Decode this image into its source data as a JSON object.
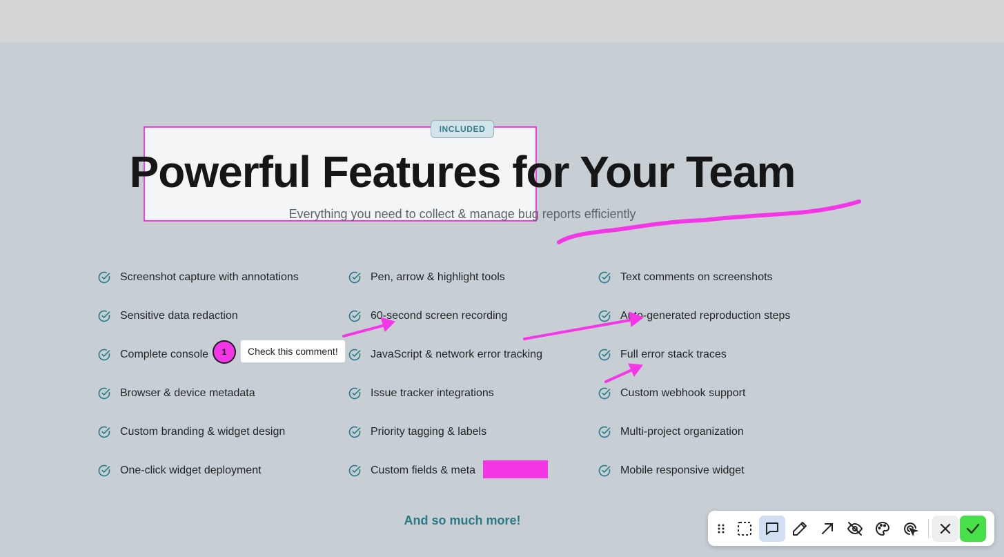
{
  "header": {
    "badge": "INCLUDED",
    "title": "Powerful Features for Your Team",
    "subtitle": "Everything you need to collect & manage bug reports efficiently"
  },
  "features": [
    {
      "label": "Screenshot capture with annotations",
      "icon": "check-circle-icon"
    },
    {
      "label": "Pen, arrow & highlight tools",
      "icon": "check-circle-icon"
    },
    {
      "label": "Text comments on screenshots",
      "icon": "check-circle-icon"
    },
    {
      "label": "Sensitive data redaction",
      "icon": "check-circle-icon"
    },
    {
      "label": "60-second screen recording",
      "icon": "check-circle-icon"
    },
    {
      "label": "Auto-generated reproduction steps",
      "icon": "check-circle-icon"
    },
    {
      "label": "Complete console",
      "icon": "check-circle-icon"
    },
    {
      "label": "JavaScript & network error tracking",
      "icon": "check-circle-icon"
    },
    {
      "label": "Full error stack traces",
      "icon": "check-circle-icon"
    },
    {
      "label": "Browser & device metadata",
      "icon": "check-circle-icon"
    },
    {
      "label": "Issue tracker integrations",
      "icon": "check-circle-icon"
    },
    {
      "label": "Custom webhook support",
      "icon": "check-circle-icon"
    },
    {
      "label": "Custom branding & widget design",
      "icon": "check-circle-icon"
    },
    {
      "label": "Priority tagging & labels",
      "icon": "check-circle-icon"
    },
    {
      "label": "Multi-project organization",
      "icon": "check-circle-icon"
    },
    {
      "label": "One-click widget deployment",
      "icon": "check-circle-icon"
    },
    {
      "label": "Custom fields & meta",
      "icon": "check-circle-icon"
    },
    {
      "label": "Mobile responsive widget",
      "icon": "check-circle-icon"
    }
  ],
  "more_link": "And so much more!",
  "annotation": {
    "marker_number": "1",
    "comment_text": "Check this comment!",
    "color": "#f437e6"
  },
  "toolbar": {
    "tools": [
      {
        "name": "drag-handle-icon",
        "active": false
      },
      {
        "name": "select-region-icon",
        "active": false
      },
      {
        "name": "comment-icon",
        "active": true
      },
      {
        "name": "pen-icon",
        "active": false
      },
      {
        "name": "arrow-icon",
        "active": false
      },
      {
        "name": "hide-icon",
        "active": false
      },
      {
        "name": "palette-icon",
        "active": false
      },
      {
        "name": "cursor-click-icon",
        "active": false
      },
      {
        "name": "close-icon",
        "active": false
      },
      {
        "name": "confirm-check-icon",
        "active": false
      }
    ]
  },
  "colors": {
    "accent": "#2a7a88",
    "annotation": "#f437e6",
    "confirm": "#47e048",
    "background": "#c8cfd4"
  }
}
